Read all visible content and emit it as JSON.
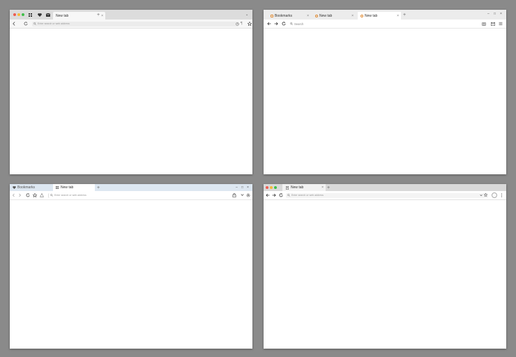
{
  "windows": [
    {
      "id": "w1",
      "tabs": [
        {
          "label": "New tab"
        }
      ],
      "address_placeholder": "Enter search or web address"
    },
    {
      "id": "w2",
      "tabs": [
        {
          "label": "Bookmarks"
        },
        {
          "label": "New tab"
        },
        {
          "label": "New tab"
        }
      ],
      "address_placeholder": "Search"
    },
    {
      "id": "w3",
      "tabs": [
        {
          "label": "Bookmarks"
        },
        {
          "label": "New tab"
        }
      ],
      "address_placeholder": "Enter search or web address"
    },
    {
      "id": "w4",
      "tabs": [
        {
          "label": "New tab"
        }
      ],
      "address_placeholder": "Enter search or web address"
    }
  ],
  "colors": {
    "desktop": "#8a8a8a",
    "traffic_red": "#ee5b4f",
    "traffic_yellow": "#f5b93a",
    "traffic_green": "#3fbf4a",
    "favicon_orange": "#e08a30",
    "w3_chrome": "#dde7f1"
  },
  "icons": [
    "back-icon",
    "forward-icon",
    "reload-icon",
    "star-icon",
    "menu-icon",
    "close-icon",
    "minimize-icon",
    "maximize-icon",
    "plus-icon",
    "heart-icon",
    "mail-icon",
    "grid-icon",
    "camera-icon",
    "shield-icon",
    "search-icon"
  ]
}
